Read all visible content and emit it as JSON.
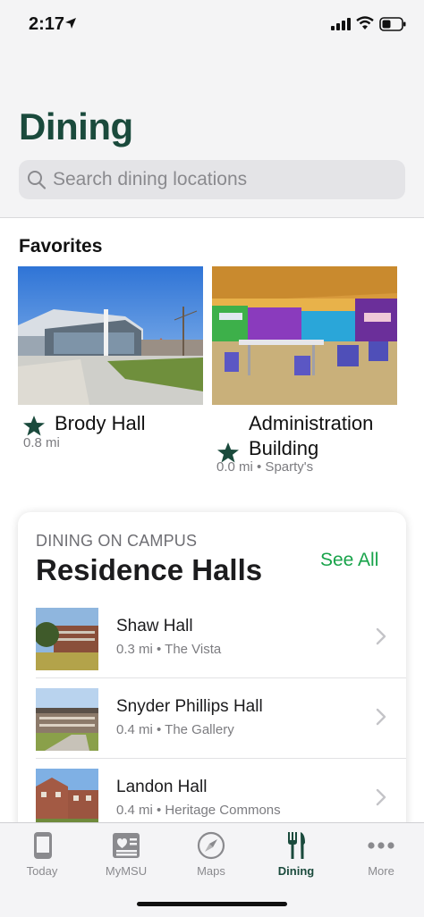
{
  "status_bar": {
    "time": "2:17"
  },
  "header": {
    "title": "Dining"
  },
  "search": {
    "placeholder": "Search dining locations",
    "value": ""
  },
  "favorites": {
    "title": "Favorites",
    "items": [
      {
        "name": "Brody Hall",
        "meta": "0.8 mi"
      },
      {
        "name": "Administration Building",
        "meta": "0.0 mi • Sparty's"
      }
    ]
  },
  "residence": {
    "eyebrow": "DINING ON CAMPUS",
    "title": "Residence Halls",
    "see_all": "See All",
    "items": [
      {
        "name": "Shaw Hall",
        "meta": "0.3 mi • The Vista"
      },
      {
        "name": "Snyder Phillips Hall",
        "meta": "0.4 mi • The Gallery"
      },
      {
        "name": "Landon Hall",
        "meta": "0.4 mi • Heritage Commons"
      }
    ]
  },
  "tabs": [
    {
      "label": "Today",
      "icon": "phone-icon"
    },
    {
      "label": "MyMSU",
      "icon": "news-icon"
    },
    {
      "label": "Maps",
      "icon": "compass-icon"
    },
    {
      "label": "Dining",
      "icon": "fork-knife-icon",
      "active": true
    },
    {
      "label": "More",
      "icon": "more-icon"
    }
  ],
  "colors": {
    "brand_green": "#1a4a3c",
    "link_green": "#18a34a",
    "inactive": "#8a8a8e"
  }
}
